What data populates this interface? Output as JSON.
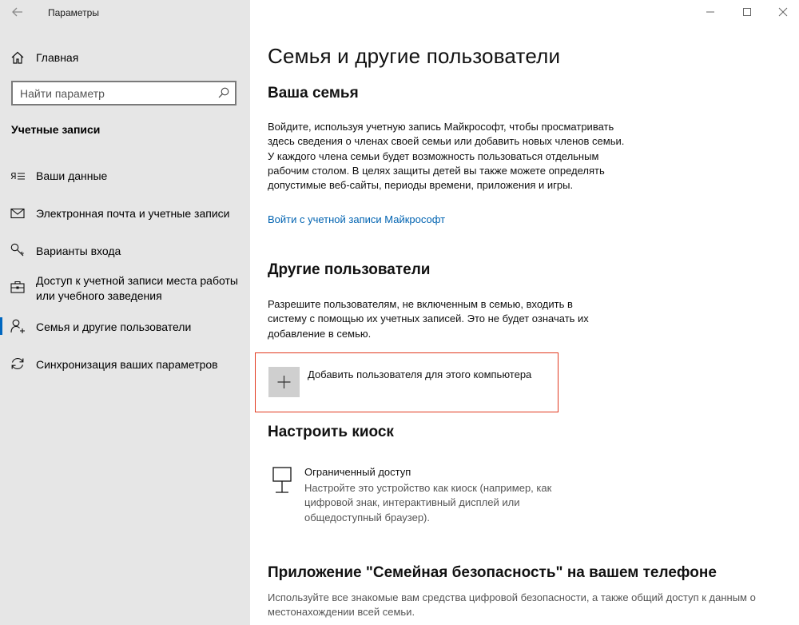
{
  "window": {
    "title": "Параметры"
  },
  "sidebar": {
    "home_label": "Главная",
    "search_placeholder": "Найти параметр",
    "section_heading": "Учетные записи",
    "items": [
      {
        "label": "Ваши данные",
        "icon": "user-info-icon"
      },
      {
        "label": "Электронная почта и учетные записи",
        "icon": "mail-icon"
      },
      {
        "label": "Варианты входа",
        "icon": "key-icon"
      },
      {
        "label": "Доступ к учетной записи места работы или учебного заведения",
        "icon": "briefcase-icon"
      },
      {
        "label": "Семья и другие пользователи",
        "icon": "person-add-icon",
        "selected": true
      },
      {
        "label": "Синхронизация ваших параметров",
        "icon": "sync-icon"
      }
    ]
  },
  "main": {
    "page_title": "Семья и другие пользователи",
    "family": {
      "heading": "Ваша семья",
      "text": "Войдите, используя учетную запись Майкрософт, чтобы просматривать здесь сведения о членах своей семьи или добавить новых членов семьи. У каждого члена семьи будет возможность пользоваться отдельным рабочим столом. В целях защиты детей вы также можете определять допустимые веб-сайты, периоды времени, приложения и игры.",
      "link": "Войти с учетной записи Майкрософт"
    },
    "others": {
      "heading": "Другие пользователи",
      "text": "Разрешите пользователям, не включенным в семью, входить в систему с помощью их учетных записей. Это не будет означать их добавление в семью.",
      "add_label": "Добавить пользователя для этого компьютера"
    },
    "kiosk": {
      "heading": "Настроить киоск",
      "title": "Ограниченный доступ",
      "text": "Настройте это устройство как киоск (например, как цифровой знак, интерактивный дисплей или общедоступный браузер)."
    },
    "family_safety": {
      "heading": "Приложение \"Семейная безопасность\" на вашем телефоне",
      "text": "Используйте все знакомые вам средства цифровой безопасности, а также общий доступ к данным о местонахождении всей семьи."
    }
  },
  "colors": {
    "sidebar_bg": "#e6e6e6",
    "accent": "#0067c0",
    "link": "#0063b1",
    "highlight": "#e23a1f"
  }
}
